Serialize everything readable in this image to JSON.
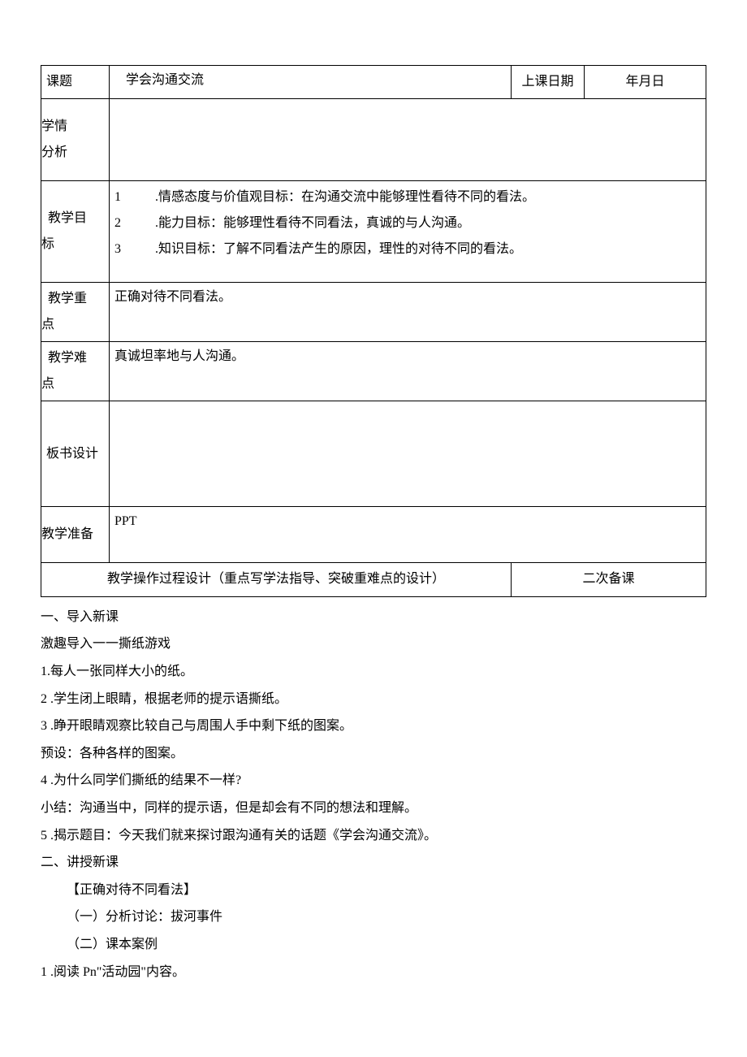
{
  "header": {
    "topic_label": "课题",
    "topic_value": "学会沟通交流",
    "date_label": "上课日期",
    "date_value": "年月日"
  },
  "rows": {
    "situation": {
      "label_l1": "学情",
      "label_l2": "分析",
      "content": ""
    },
    "objectives": {
      "label_l1": "教学目",
      "label_l2": "标",
      "items": [
        {
          "num": "1",
          "text": ".情感态度与价值观目标：在沟通交流中能够理性看待不同的看法。"
        },
        {
          "num": "2",
          "text": ".能力目标：能够理性看待不同看法，真诚的与人沟通。"
        },
        {
          "num": "3",
          "text": ".知识目标：了解不同看法产生的原因，理性的对待不同的看法。"
        }
      ]
    },
    "focus": {
      "label_l1": "教学重",
      "label_l2": "点",
      "content": "正确对待不同看法。"
    },
    "difficulty": {
      "label_l1": "教学难",
      "label_l2": "点",
      "content": "真诚坦率地与人沟通。"
    },
    "board": {
      "label": "板书设计",
      "content": ""
    },
    "prep": {
      "label": "教学准备",
      "content": "PPT"
    }
  },
  "section_headers": {
    "process": "教学操作过程设计（重点写学法指导、突破重难点的设计）",
    "secondary": "二次备课"
  },
  "content": {
    "lines": [
      {
        "text": "一、导入新课",
        "indent": 0
      },
      {
        "text": "激趣导入一一撕纸游戏",
        "indent": 0
      },
      {
        "text": "1.每人一张同样大小的纸。",
        "indent": 0
      },
      {
        "text": "2 .学生闭上眼睛，根据老师的提示语撕纸。",
        "indent": 0
      },
      {
        "text": "3 .睁开眼睛观察比较自己与周围人手中剩下纸的图案。",
        "indent": 0
      },
      {
        "text": "预设：各种各样的图案。",
        "indent": 0
      },
      {
        "text": "4 .为什么同学们撕纸的结果不一样?",
        "indent": 0
      },
      {
        "text": "小结：沟通当中，同样的提示语，但是却会有不同的想法和理解。",
        "indent": 0
      },
      {
        "text": "5 .揭示题目：今天我们就来探讨跟沟通有关的话题《学会沟通交流》。",
        "indent": 0
      },
      {
        "text": "二、讲授新课",
        "indent": 0
      },
      {
        "text": "【正确对待不同看法】",
        "indent": 1
      },
      {
        "text": "（一）分析讨论：拔河事件",
        "indent": 1
      },
      {
        "text": "（二）课本案例",
        "indent": 1
      },
      {
        "text": "1 .阅读 Pn\"活动园\"内容。",
        "indent": 0
      }
    ]
  }
}
